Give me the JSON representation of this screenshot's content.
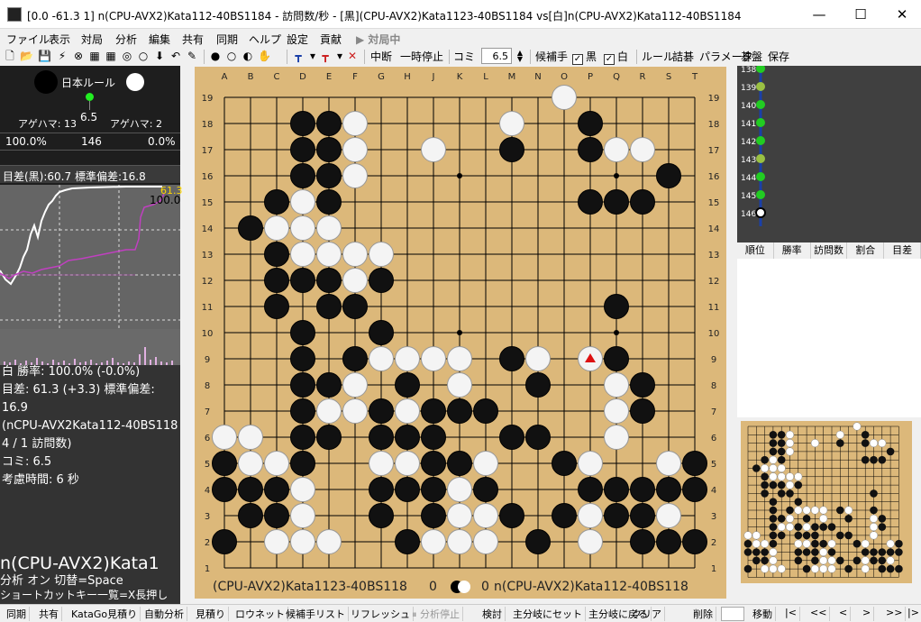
{
  "window": {
    "title": "[0.0 -61.3 1] n(CPU-AVX2)Kata112-40BS1184 - 訪問数/秒 - [黒](CPU-AVX2)Kata1123-40BS1184 vs[白]n(CPU-AVX2)Kata112-40BS1184",
    "minimize": "—",
    "maximize": "☐",
    "close": "✕"
  },
  "menu": [
    "ファイル",
    "表示",
    "対局",
    "分析",
    "編集",
    "共有",
    "同期",
    "ヘルプ",
    "設定",
    "貢献"
  ],
  "menu_status": "▶ 対局中",
  "toolbar": {
    "interrupt": "中断",
    "pause": "一時停止",
    "komi_label": "コミ",
    "komi_value": "6.5",
    "candidates_label": "候補手",
    "black_label": "黒",
    "white_label": "白",
    "rule": "ルール",
    "tsumego": "詰碁",
    "params": "パラメータ",
    "board": "碁盤",
    "save": "保存",
    "icons": [
      "new-file-icon",
      "open-folder-icon",
      "save-icon",
      "lightning-icon",
      "katago-icon",
      "chart-icon",
      "chart2-icon",
      "hand-icon",
      "arrow-down-icon",
      "back-icon",
      "pen-icon",
      "black-stone-icon",
      "white-stone-icon",
      "stone-mix-icon",
      "hand-icon"
    ]
  },
  "status": {
    "rule": "日本ルール",
    "komi": "6.5",
    "agehama_black": "アゲハマ: 13",
    "agehama_white": "アゲハマ: 2",
    "winrate_left": "100.0%",
    "move_count": "146",
    "winrate_right": "0.0%",
    "score_line": "目差(黒):60.7  標準偏差:16.8",
    "graph_label_top": "61.3",
    "graph_label_value": "100.0"
  },
  "info": {
    "line1": "白 勝率: 100.0% (-0.0%)",
    "line2": "目差: 61.3 (+3.3) 標準偏差:",
    "line3": "16.9",
    "line4": "(nCPU-AVX2Kata112-40BS118",
    "line5": "4 / 1 訪問数)",
    "line6": "コミ: 6.5",
    "line7": "考慮時間: 6 秒"
  },
  "bottom_left": {
    "name": "n(CPU-AVX2)Kata1",
    "analysis": "分析 オン  切替=Space",
    "shortcut": "ショートカットキー一覧=X長押し"
  },
  "board": {
    "columns": [
      "A",
      "B",
      "C",
      "D",
      "E",
      "F",
      "G",
      "H",
      "J",
      "K",
      "L",
      "M",
      "N",
      "O",
      "P",
      "Q",
      "R",
      "S",
      "T"
    ],
    "rows": [
      "19",
      "18",
      "17",
      "16",
      "15",
      "14",
      "13",
      "12",
      "11",
      "10",
      "9",
      "8",
      "7",
      "6",
      "5",
      "4",
      "3",
      "2",
      "1"
    ],
    "stones": [
      ".............W.....",
      "...BBW.....W..B....",
      "...BBW..W..B..BWW..",
      "...BBW...........B.",
      "..BWB.........BBB..",
      ".BWWW..............",
      "..BWWWW............",
      "..BBBWB............",
      "..B.BB.........B...",
      "...B..B............",
      "...B.BWWWW.BW..B...",
      "...BBW.B.W..B..WB..",
      "...BWWBWBBB....WB..",
      "WW.BB.BBB..BB..W...",
      "BWWB..WWBBW..BW..WB",
      "BBBW..BBBWB...BBBBB",
      ".BBW..B.BWWB.BWBBW.",
      "B.WWW..BWWW.B.W.BBB",
      "..................."
    ],
    "last_move": "P9",
    "player_black": "(CPU-AVX2)Kata1123-40BS118",
    "captures_black": "0",
    "captures_white": "0",
    "player_white": "n(CPU-AVX2)Kata112-40BS118"
  },
  "movelist": [
    "138",
    "139",
    "140",
    "141",
    "142",
    "143",
    "144",
    "145",
    "146"
  ],
  "tabs": [
    "順位",
    "勝率",
    "訪問数",
    "割合",
    "目差"
  ],
  "bottom_buttons": [
    "同期",
    "共有",
    "KataGo見積り",
    "自動分析",
    "見積り",
    "ロウネット",
    "候補手リスト",
    "リフレッシュ",
    "⏸ 分析停止",
    "検討",
    "主分岐にセット",
    "主分岐に戻る",
    "クリア",
    "削除",
    "",
    "移動",
    "|<",
    "<<",
    "<",
    ">",
    ">>",
    "|>"
  ]
}
